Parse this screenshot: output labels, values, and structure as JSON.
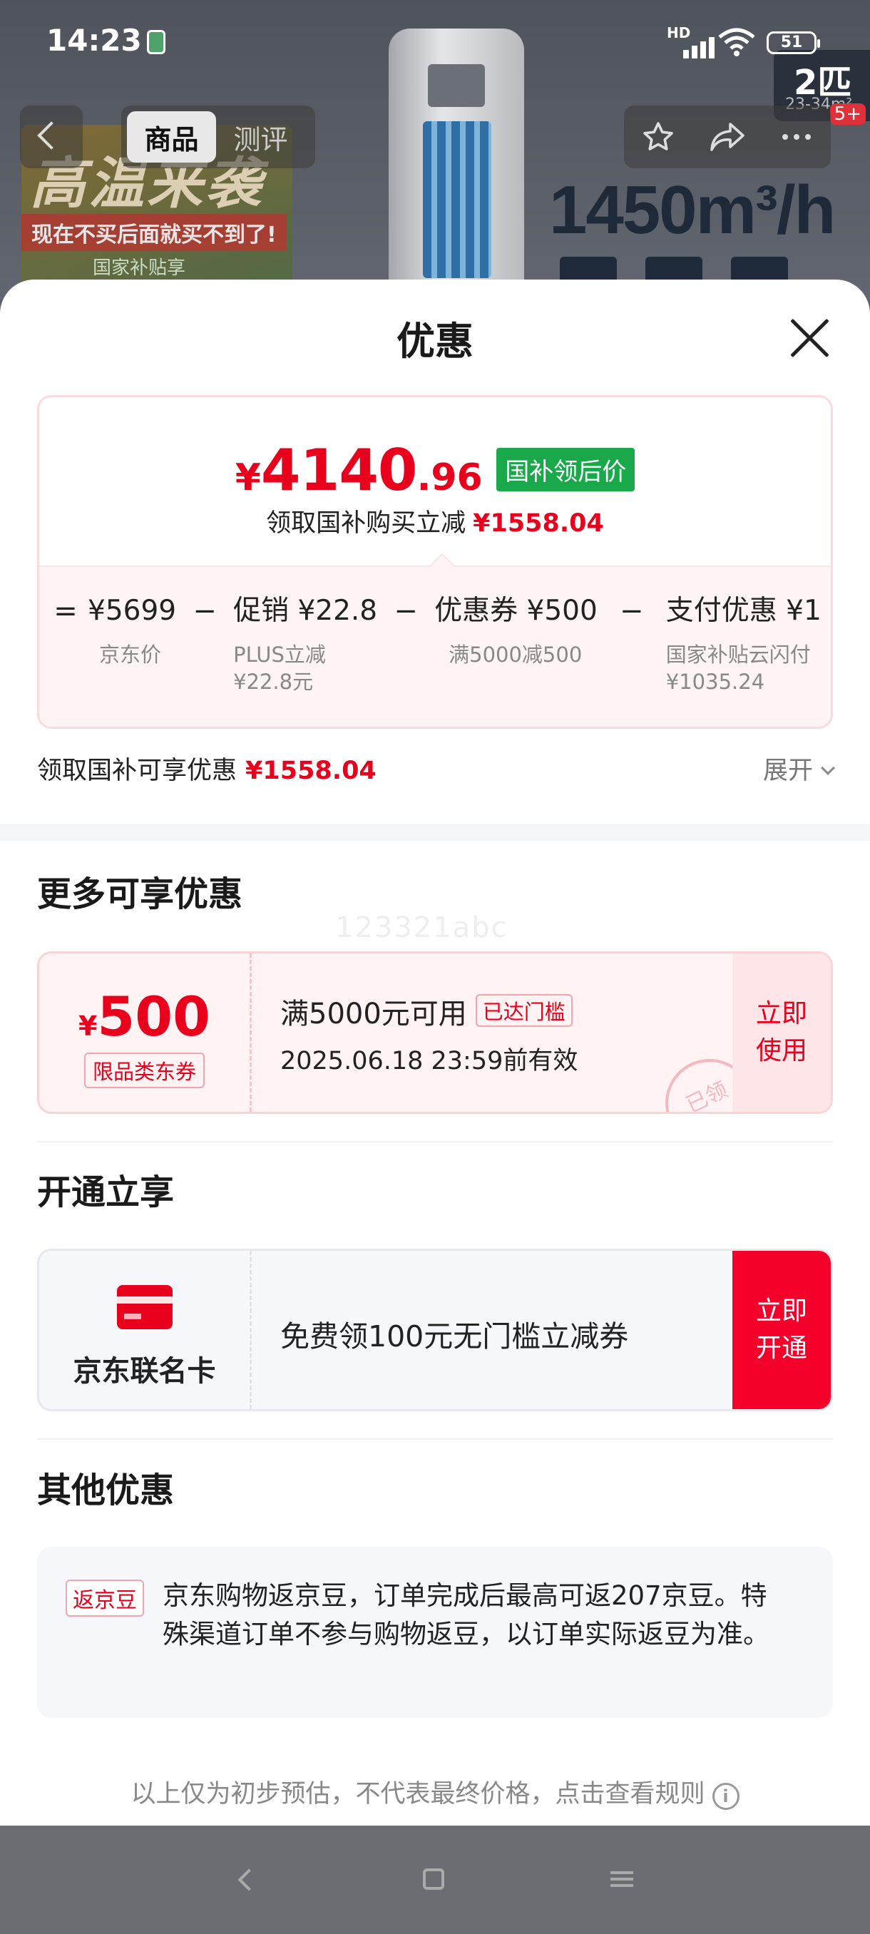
{
  "status_bar": {
    "time": "14:23",
    "network": "HD",
    "battery": "51"
  },
  "product_bg": {
    "promo_headline": "高温来袭",
    "promo_sub": "现在不买后面就买不到了!",
    "promo_gov": "国家补贴享",
    "airflow": "1450m³/h",
    "spec_big": "2匹",
    "spec_small": "23-34m²",
    "spec_badge": "5+"
  },
  "nav": {
    "tabs": [
      "商品",
      "测评"
    ],
    "active_tab": "商品"
  },
  "sheet": {
    "title": "优惠",
    "price": {
      "yen": "¥",
      "integer": "4140",
      "decimal": ".96",
      "tag": "国补领后价"
    },
    "reduction_label": "领取国补购买立减",
    "reduction_amount": "¥1558.04",
    "formula": [
      {
        "value": "¥5699",
        "label": "京东价",
        "label2": ""
      },
      {
        "value": "促销 ¥22.8",
        "label": "PLUS立减",
        "label2": "¥22.8元"
      },
      {
        "value": "优惠券 ¥500",
        "label": "满5000减500",
        "label2": ""
      },
      {
        "value": "支付优惠 ¥1",
        "label": "国家补贴云闪付",
        "label2": "¥1035.24"
      }
    ],
    "operators": {
      "equals": "=",
      "minus": "−"
    },
    "discount_row": {
      "label": "领取国补可享优惠",
      "amount": "¥1558.04",
      "expand": "展开"
    },
    "more_title": "更多可享优惠",
    "coupon": {
      "yen": "¥",
      "amount": "500",
      "category": "限品类东券",
      "condition": "满5000元可用",
      "reached": "已达门槛",
      "expiry": "2025.06.18 23:59前有效",
      "use_line1": "立即",
      "use_line2": "使用",
      "stamp": "已领"
    },
    "watermark": "123321abc",
    "open_title": "开通立享",
    "card_offer": {
      "name": "京东联名卡",
      "desc": "免费领100元无门槛立减券",
      "btn_line1": "立即",
      "btn_line2": "开通"
    },
    "other_title": "其他优惠",
    "other": {
      "tag": "返京豆",
      "text": "京东购物返京豆，订单完成后最高可返207京豆。特殊渠道订单不参与购物返豆，以订单实际返豆为准。"
    },
    "footnote": "以上仅为初步预估，不代表最终价格，点击查看规则",
    "info_icon_glyph": "i"
  },
  "colors": {
    "accent_red": "#e8001c",
    "gov_green": "#19a84a",
    "button_red": "#f5002a"
  }
}
